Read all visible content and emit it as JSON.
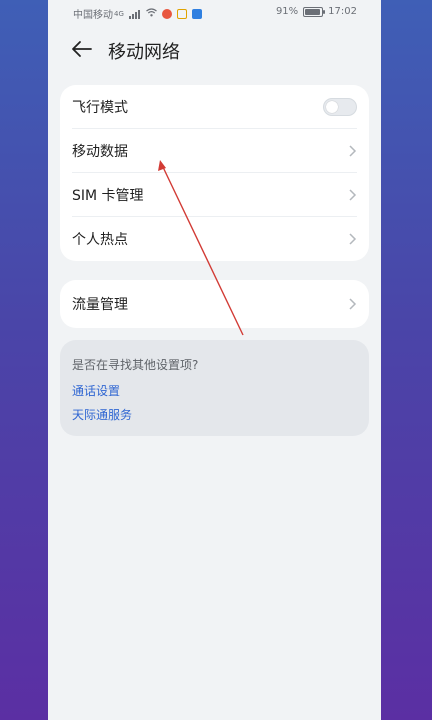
{
  "status_bar": {
    "carrier": "中国移动",
    "network": "4G",
    "battery": "91%",
    "battery_level": 0.91,
    "time": "17:02"
  },
  "header": {
    "title": "移动网络"
  },
  "settings_group_1": [
    {
      "label": "飞行模式",
      "type": "toggle",
      "state": "off"
    },
    {
      "label": "移动数据",
      "type": "link"
    },
    {
      "label": "SIM 卡管理",
      "type": "link"
    },
    {
      "label": "个人热点",
      "type": "link"
    }
  ],
  "settings_group_2": [
    {
      "label": "流量管理",
      "type": "link"
    }
  ],
  "suggestions": {
    "question": "是否在寻找其他设置项?",
    "links": [
      "通话设置",
      "天际通服务"
    ]
  },
  "colors": {
    "link": "#2f66d2",
    "annotation": "#d23b35"
  }
}
